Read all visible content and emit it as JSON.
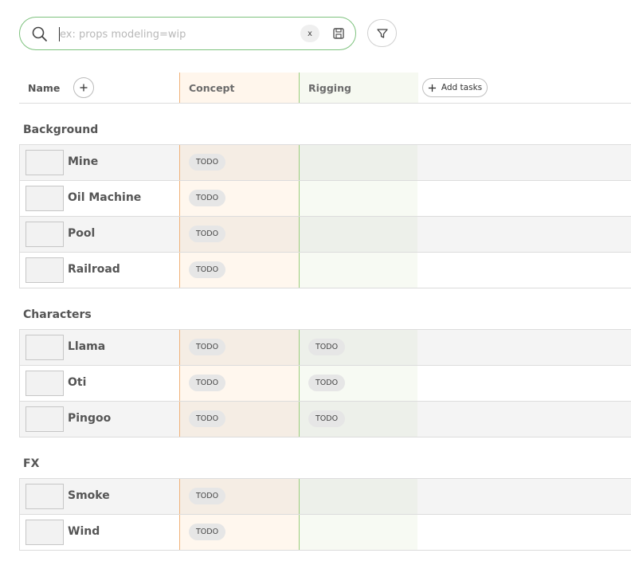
{
  "search": {
    "placeholder": "ex: props modeling=wip",
    "clear_label": "x"
  },
  "columns": {
    "name": "Name",
    "concept": "Concept",
    "rigging": "Rigging",
    "add_tasks": "Add tasks"
  },
  "icons": {
    "search": "search-icon",
    "save": "save-icon",
    "filter": "filter-icon",
    "plus": "plus-icon"
  },
  "colors": {
    "concept_accent": "#f0b27a",
    "rigging_accent": "#9ccd7c",
    "search_border": "#7ec27e"
  },
  "groups": [
    {
      "title": "Background",
      "rows": [
        {
          "name": "Mine",
          "concept": "TODO",
          "rigging": ""
        },
        {
          "name": "Oil Machine",
          "concept": "TODO",
          "rigging": ""
        },
        {
          "name": "Pool",
          "concept": "TODO",
          "rigging": ""
        },
        {
          "name": "Railroad",
          "concept": "TODO",
          "rigging": ""
        }
      ]
    },
    {
      "title": "Characters",
      "rows": [
        {
          "name": "Llama",
          "concept": "TODO",
          "rigging": "TODO"
        },
        {
          "name": "Oti",
          "concept": "TODO",
          "rigging": "TODO"
        },
        {
          "name": "Pingoo",
          "concept": "TODO",
          "rigging": "TODO"
        }
      ]
    },
    {
      "title": "FX",
      "rows": [
        {
          "name": "Smoke",
          "concept": "TODO",
          "rigging": ""
        },
        {
          "name": "Wind",
          "concept": "TODO",
          "rigging": ""
        }
      ]
    }
  ]
}
